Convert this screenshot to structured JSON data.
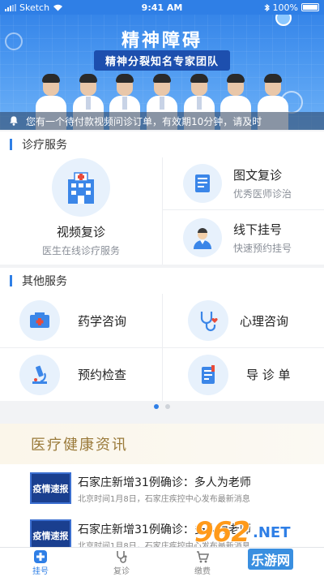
{
  "status_bar": {
    "carrier": "Sketch",
    "time": "9:41 AM",
    "battery": "100%"
  },
  "banner": {
    "title": "精神障碍",
    "subtitle": "精神分裂知名专家团队",
    "notice": "您有一个待付款视频问诊订单，有效期10分钟，请及时"
  },
  "diagnosis": {
    "header": "诊疗服务",
    "video": {
      "label": "视频复诊",
      "desc": "医生在线诊疗服务"
    },
    "image_text": {
      "label": "图文复诊",
      "desc": "优秀医师诊治"
    },
    "offline": {
      "label": "线下挂号",
      "desc": "快速预约挂号"
    }
  },
  "other": {
    "header": "其他服务",
    "items": [
      {
        "label": "药学咨询",
        "icon": "medicine-box-icon"
      },
      {
        "label": "心理咨询",
        "icon": "stethoscope-heart-icon"
      },
      {
        "label": "预约检查",
        "icon": "microscope-icon"
      },
      {
        "label": "导 诊 单",
        "icon": "guide-list-icon"
      }
    ]
  },
  "pager": {
    "pages": 2,
    "active": 0
  },
  "news": {
    "header": "医疗健康资讯",
    "items": [
      {
        "thumb": "疫情速报",
        "headline": "石家庄新增31例确诊：多人为老师",
        "desc": "北京时间1月8日，石家庄疾控中心发布最新消息"
      },
      {
        "thumb": "疫情速报",
        "headline": "石家庄新增31例确诊：多人为老师",
        "desc": "北京时间1月8日，石家庄疾控中心发布最新消息"
      }
    ]
  },
  "tabs": [
    {
      "label": "挂号",
      "icon": "plus-cross-icon"
    },
    {
      "label": "复诊",
      "icon": "stethoscope-icon"
    },
    {
      "label": "缴费",
      "icon": "cart-icon"
    },
    {
      "label": "",
      "icon": ""
    }
  ],
  "watermark": {
    "logo": "962",
    "net": ".NET",
    "sub": "乐游网"
  },
  "colors": {
    "primary": "#2f7fe6",
    "news_title": "#9a7a3a"
  }
}
